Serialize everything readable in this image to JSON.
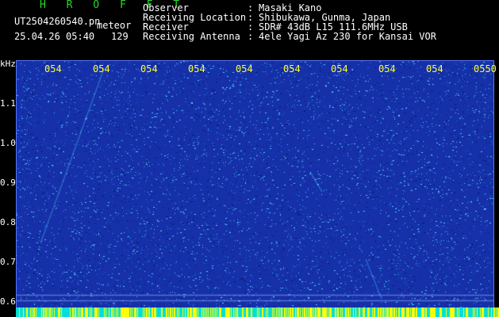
{
  "header": {
    "brand": "H R O F F T",
    "filename": "UT2504260540.pn",
    "type_label": "meteor",
    "datetime": "25.04.26 05:40",
    "count": "129"
  },
  "info": [
    {
      "label": "Observer",
      "value": "Masaki Kano"
    },
    {
      "label": "Receiving Location",
      "value": "Shibukawa, Gunma, Japan"
    },
    {
      "label": "Receiver",
      "value": "SDR# 43dB L15 111.6MHz USB"
    },
    {
      "label": "Receiving Antenna",
      "value": "4ele Yagi Az 230 for Kansai VOR"
    }
  ],
  "spectrogram": {
    "y_unit": "kHz",
    "y_ticks": [
      "1.1",
      "1.0",
      "0.9",
      "0.8",
      "0.7",
      "0.6"
    ],
    "y_tick_values": [
      1.1,
      1.0,
      0.9,
      0.8,
      0.7,
      0.6
    ],
    "y_range": [
      0.58,
      1.2
    ],
    "x_ticks": [
      "054",
      "054",
      "054",
      "054",
      "054",
      "054",
      "054",
      "054",
      "054",
      "0550"
    ],
    "colors": {
      "background": "#1530a8",
      "speckle_light": "#55ccff",
      "speckle_mid": "#2a6fe0",
      "speckle_dark": "#0a1a6a",
      "tick_label": "#ffff33",
      "bottom_bar_primary": "#00dddd",
      "bottom_bar_secondary": "#ffff00"
    }
  }
}
